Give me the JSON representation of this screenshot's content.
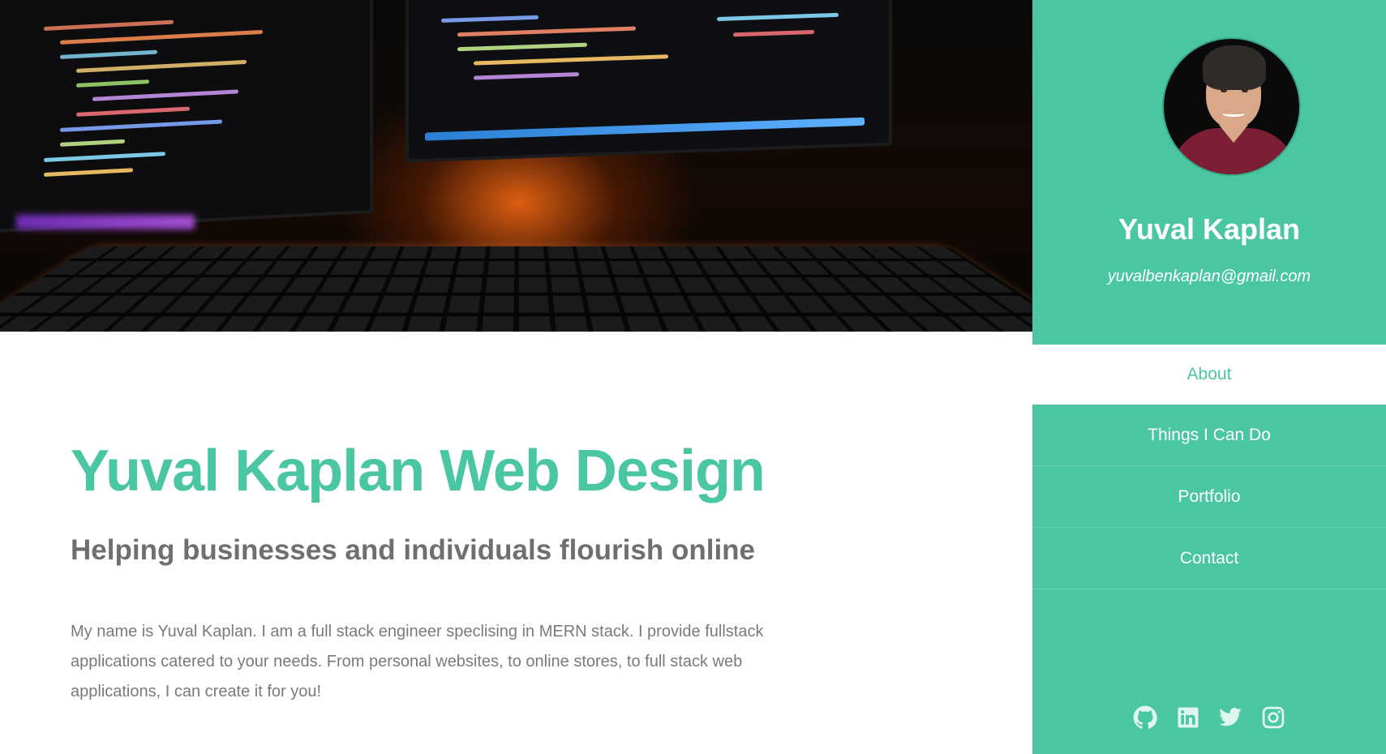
{
  "hero": {
    "image_alt": "desk-with-monitors-and-keyboard-photo"
  },
  "main": {
    "title": "Yuval Kaplan Web Design",
    "tagline": "Helping businesses and individuals flourish online",
    "intro": "My name is Yuval Kaplan. I am a full stack engineer speclising in MERN stack. I provide fullstack applications catered to your needs. From personal websites, to online stores, to full stack web applications, I can create it for you!"
  },
  "sidebar": {
    "name": "Yuval Kaplan",
    "email": "yuvalbenkaplan@gmail.com",
    "nav": [
      {
        "label": "About",
        "active": true
      },
      {
        "label": "Things I Can Do",
        "active": false
      },
      {
        "label": "Portfolio",
        "active": false
      },
      {
        "label": "Contact",
        "active": false
      }
    ],
    "social": [
      "github-icon",
      "linkedin-icon",
      "twitter-icon",
      "instagram-icon"
    ]
  },
  "colors": {
    "accent": "#4ac6a3",
    "heading_gray": "#6f6f6f",
    "body_gray": "#7a7a7a",
    "white": "#ffffff"
  }
}
